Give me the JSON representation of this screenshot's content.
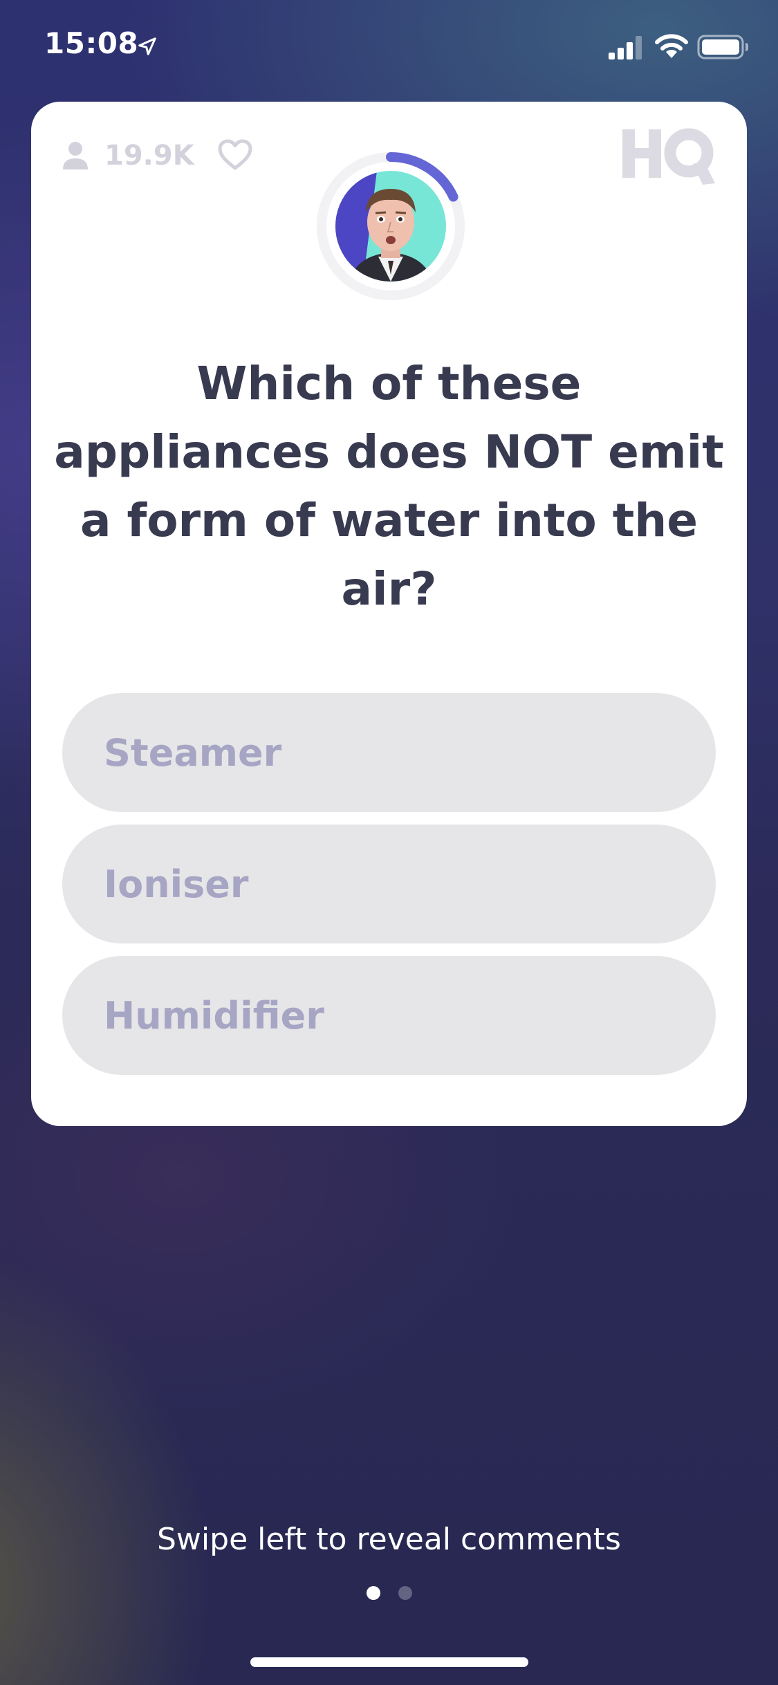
{
  "status_bar": {
    "time": "15:08",
    "icons": [
      "location-arrow-icon",
      "cellular-signal-icon",
      "wifi-icon",
      "battery-icon"
    ]
  },
  "card": {
    "viewer_count": "19.9K",
    "icons": [
      "user-icon",
      "heart-icon"
    ],
    "logo": "HQ",
    "timer_progress": 0.18,
    "question": "Which of these appliances does NOT emit a form of water into the air?",
    "answers": [
      {
        "label": "Steamer"
      },
      {
        "label": "Ioniser"
      },
      {
        "label": "Humidifier"
      }
    ]
  },
  "footer": {
    "swipe_hint": "Swipe left to reveal comments",
    "page_dots": {
      "count": 2,
      "active": 0
    }
  },
  "colors": {
    "card_background": "#ffffff",
    "question_text": "#383a50",
    "answer_background": "#e6e6e8",
    "answer_text": "#a7a5c4",
    "muted_icon": "#d3d2dc",
    "timer_ring_progress": "#6466d6",
    "timer_ring_track": "#f2f2f4"
  }
}
